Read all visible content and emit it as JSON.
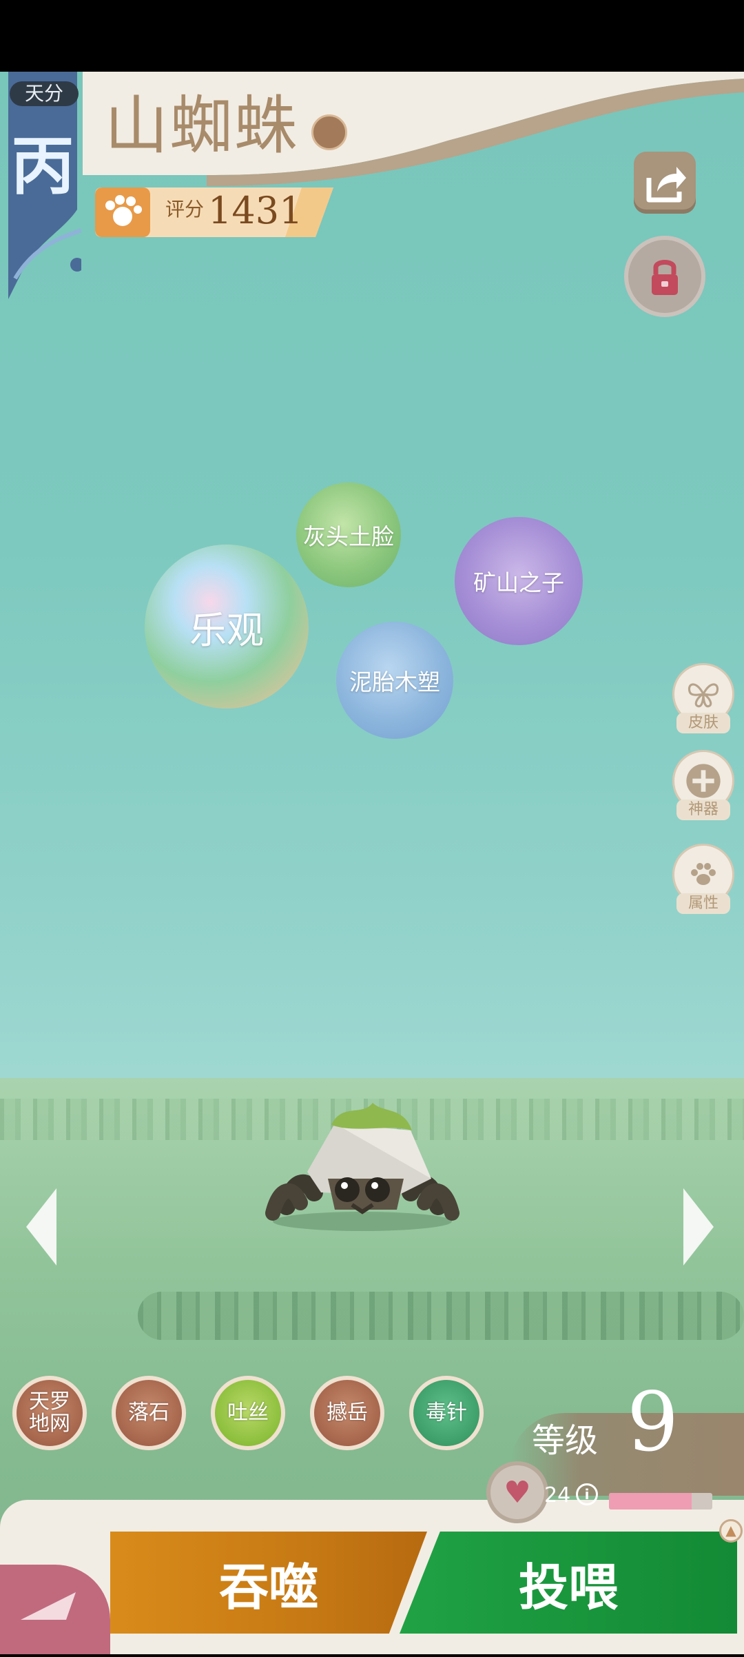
{
  "header": {
    "tier_label": "天分",
    "tier_value": "丙",
    "pet_name": "山蜘蛛",
    "score_label": "评分",
    "score_value": "1431"
  },
  "personality_bubbles": [
    {
      "label": "乐观"
    },
    {
      "label": "灰头土脸"
    },
    {
      "label": "矿山之子"
    },
    {
      "label": "泥胎木塑"
    }
  ],
  "side_menu": [
    {
      "label": "皮肤",
      "icon": "butterfly-icon"
    },
    {
      "label": "神器",
      "icon": "plus-icon"
    },
    {
      "label": "属性",
      "icon": "paw-icon"
    }
  ],
  "skills": [
    {
      "label": "天罗\n地网"
    },
    {
      "label": "落石"
    },
    {
      "label": "吐丝"
    },
    {
      "label": "撼岳"
    },
    {
      "label": "毒针"
    }
  ],
  "level": {
    "label": "等级",
    "value": "9"
  },
  "health": {
    "value": "24",
    "fill_fraction": 0.8
  },
  "actions": {
    "devour_label": "吞噬",
    "feed_label": "投喂"
  },
  "colors": {
    "devour": "#c77a14",
    "feed": "#138a35",
    "background": "#7dc9bf"
  }
}
